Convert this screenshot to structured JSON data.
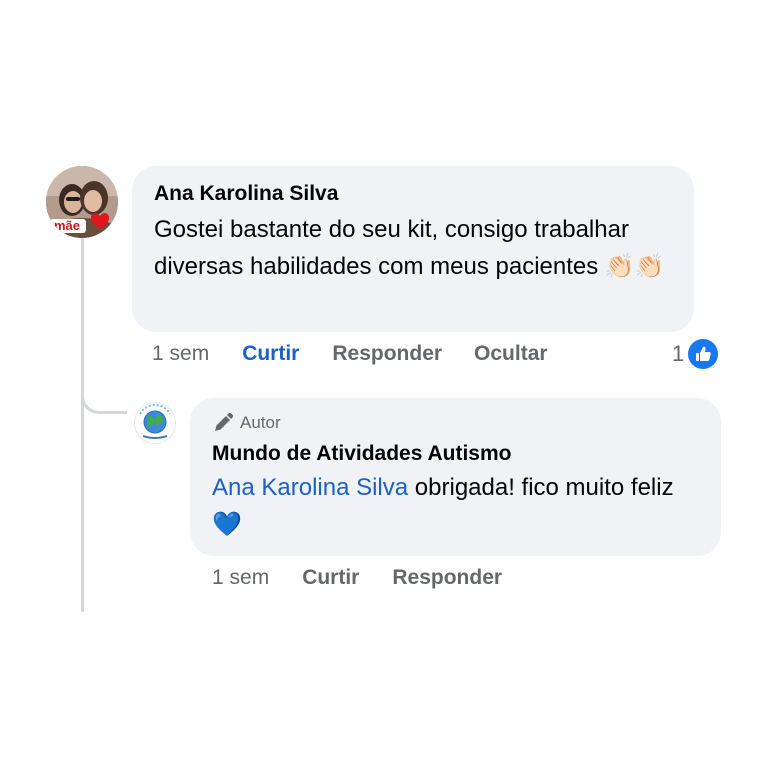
{
  "comment": {
    "author": "Ana Karolina Silva",
    "avatar_label": "mãe",
    "text": "Gostei bastante do seu kit, consigo trabalhar diversas habilidades com meus pacientes",
    "emoji": "👏🏻👏🏻",
    "time": "1 sem",
    "actions": {
      "like": "Curtir",
      "reply": "Responder",
      "hide": "Ocultar"
    },
    "reaction_count": "1",
    "reaction_icon": "like-icon",
    "accent_color": "#1b5fc9"
  },
  "reply": {
    "badge": "Autor",
    "badge_icon": "pencil-icon",
    "author": "Mundo de Atividades Autismo",
    "mention": "Ana Karolina Silva",
    "text": " obrigada! fico muito feliz ",
    "emoji": "💙",
    "time": "1 sem",
    "actions": {
      "like": "Curtir",
      "reply": "Responder"
    }
  }
}
